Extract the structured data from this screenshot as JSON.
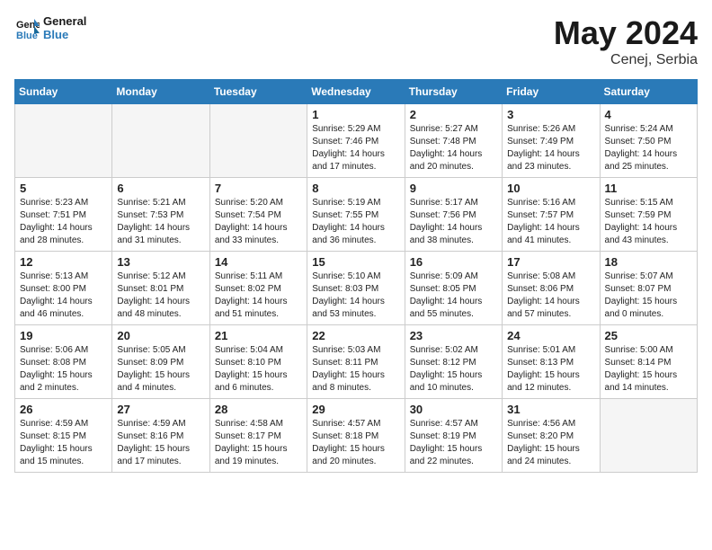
{
  "header": {
    "logo_line1": "General",
    "logo_line2": "Blue",
    "month_title": "May 2024",
    "location": "Cenej, Serbia"
  },
  "weekdays": [
    "Sunday",
    "Monday",
    "Tuesday",
    "Wednesday",
    "Thursday",
    "Friday",
    "Saturday"
  ],
  "weeks": [
    {
      "days": [
        {
          "num": "",
          "info": "",
          "empty": true
        },
        {
          "num": "",
          "info": "",
          "empty": true
        },
        {
          "num": "",
          "info": "",
          "empty": true
        },
        {
          "num": "1",
          "info": "Sunrise: 5:29 AM\nSunset: 7:46 PM\nDaylight: 14 hours\nand 17 minutes.",
          "empty": false
        },
        {
          "num": "2",
          "info": "Sunrise: 5:27 AM\nSunset: 7:48 PM\nDaylight: 14 hours\nand 20 minutes.",
          "empty": false
        },
        {
          "num": "3",
          "info": "Sunrise: 5:26 AM\nSunset: 7:49 PM\nDaylight: 14 hours\nand 23 minutes.",
          "empty": false
        },
        {
          "num": "4",
          "info": "Sunrise: 5:24 AM\nSunset: 7:50 PM\nDaylight: 14 hours\nand 25 minutes.",
          "empty": false
        }
      ]
    },
    {
      "days": [
        {
          "num": "5",
          "info": "Sunrise: 5:23 AM\nSunset: 7:51 PM\nDaylight: 14 hours\nand 28 minutes.",
          "empty": false
        },
        {
          "num": "6",
          "info": "Sunrise: 5:21 AM\nSunset: 7:53 PM\nDaylight: 14 hours\nand 31 minutes.",
          "empty": false
        },
        {
          "num": "7",
          "info": "Sunrise: 5:20 AM\nSunset: 7:54 PM\nDaylight: 14 hours\nand 33 minutes.",
          "empty": false
        },
        {
          "num": "8",
          "info": "Sunrise: 5:19 AM\nSunset: 7:55 PM\nDaylight: 14 hours\nand 36 minutes.",
          "empty": false
        },
        {
          "num": "9",
          "info": "Sunrise: 5:17 AM\nSunset: 7:56 PM\nDaylight: 14 hours\nand 38 minutes.",
          "empty": false
        },
        {
          "num": "10",
          "info": "Sunrise: 5:16 AM\nSunset: 7:57 PM\nDaylight: 14 hours\nand 41 minutes.",
          "empty": false
        },
        {
          "num": "11",
          "info": "Sunrise: 5:15 AM\nSunset: 7:59 PM\nDaylight: 14 hours\nand 43 minutes.",
          "empty": false
        }
      ]
    },
    {
      "days": [
        {
          "num": "12",
          "info": "Sunrise: 5:13 AM\nSunset: 8:00 PM\nDaylight: 14 hours\nand 46 minutes.",
          "empty": false
        },
        {
          "num": "13",
          "info": "Sunrise: 5:12 AM\nSunset: 8:01 PM\nDaylight: 14 hours\nand 48 minutes.",
          "empty": false
        },
        {
          "num": "14",
          "info": "Sunrise: 5:11 AM\nSunset: 8:02 PM\nDaylight: 14 hours\nand 51 minutes.",
          "empty": false
        },
        {
          "num": "15",
          "info": "Sunrise: 5:10 AM\nSunset: 8:03 PM\nDaylight: 14 hours\nand 53 minutes.",
          "empty": false
        },
        {
          "num": "16",
          "info": "Sunrise: 5:09 AM\nSunset: 8:05 PM\nDaylight: 14 hours\nand 55 minutes.",
          "empty": false
        },
        {
          "num": "17",
          "info": "Sunrise: 5:08 AM\nSunset: 8:06 PM\nDaylight: 14 hours\nand 57 minutes.",
          "empty": false
        },
        {
          "num": "18",
          "info": "Sunrise: 5:07 AM\nSunset: 8:07 PM\nDaylight: 15 hours\nand 0 minutes.",
          "empty": false
        }
      ]
    },
    {
      "days": [
        {
          "num": "19",
          "info": "Sunrise: 5:06 AM\nSunset: 8:08 PM\nDaylight: 15 hours\nand 2 minutes.",
          "empty": false
        },
        {
          "num": "20",
          "info": "Sunrise: 5:05 AM\nSunset: 8:09 PM\nDaylight: 15 hours\nand 4 minutes.",
          "empty": false
        },
        {
          "num": "21",
          "info": "Sunrise: 5:04 AM\nSunset: 8:10 PM\nDaylight: 15 hours\nand 6 minutes.",
          "empty": false
        },
        {
          "num": "22",
          "info": "Sunrise: 5:03 AM\nSunset: 8:11 PM\nDaylight: 15 hours\nand 8 minutes.",
          "empty": false
        },
        {
          "num": "23",
          "info": "Sunrise: 5:02 AM\nSunset: 8:12 PM\nDaylight: 15 hours\nand 10 minutes.",
          "empty": false
        },
        {
          "num": "24",
          "info": "Sunrise: 5:01 AM\nSunset: 8:13 PM\nDaylight: 15 hours\nand 12 minutes.",
          "empty": false
        },
        {
          "num": "25",
          "info": "Sunrise: 5:00 AM\nSunset: 8:14 PM\nDaylight: 15 hours\nand 14 minutes.",
          "empty": false
        }
      ]
    },
    {
      "days": [
        {
          "num": "26",
          "info": "Sunrise: 4:59 AM\nSunset: 8:15 PM\nDaylight: 15 hours\nand 15 minutes.",
          "empty": false
        },
        {
          "num": "27",
          "info": "Sunrise: 4:59 AM\nSunset: 8:16 PM\nDaylight: 15 hours\nand 17 minutes.",
          "empty": false
        },
        {
          "num": "28",
          "info": "Sunrise: 4:58 AM\nSunset: 8:17 PM\nDaylight: 15 hours\nand 19 minutes.",
          "empty": false
        },
        {
          "num": "29",
          "info": "Sunrise: 4:57 AM\nSunset: 8:18 PM\nDaylight: 15 hours\nand 20 minutes.",
          "empty": false
        },
        {
          "num": "30",
          "info": "Sunrise: 4:57 AM\nSunset: 8:19 PM\nDaylight: 15 hours\nand 22 minutes.",
          "empty": false
        },
        {
          "num": "31",
          "info": "Sunrise: 4:56 AM\nSunset: 8:20 PM\nDaylight: 15 hours\nand 24 minutes.",
          "empty": false
        },
        {
          "num": "",
          "info": "",
          "empty": true
        }
      ]
    }
  ]
}
